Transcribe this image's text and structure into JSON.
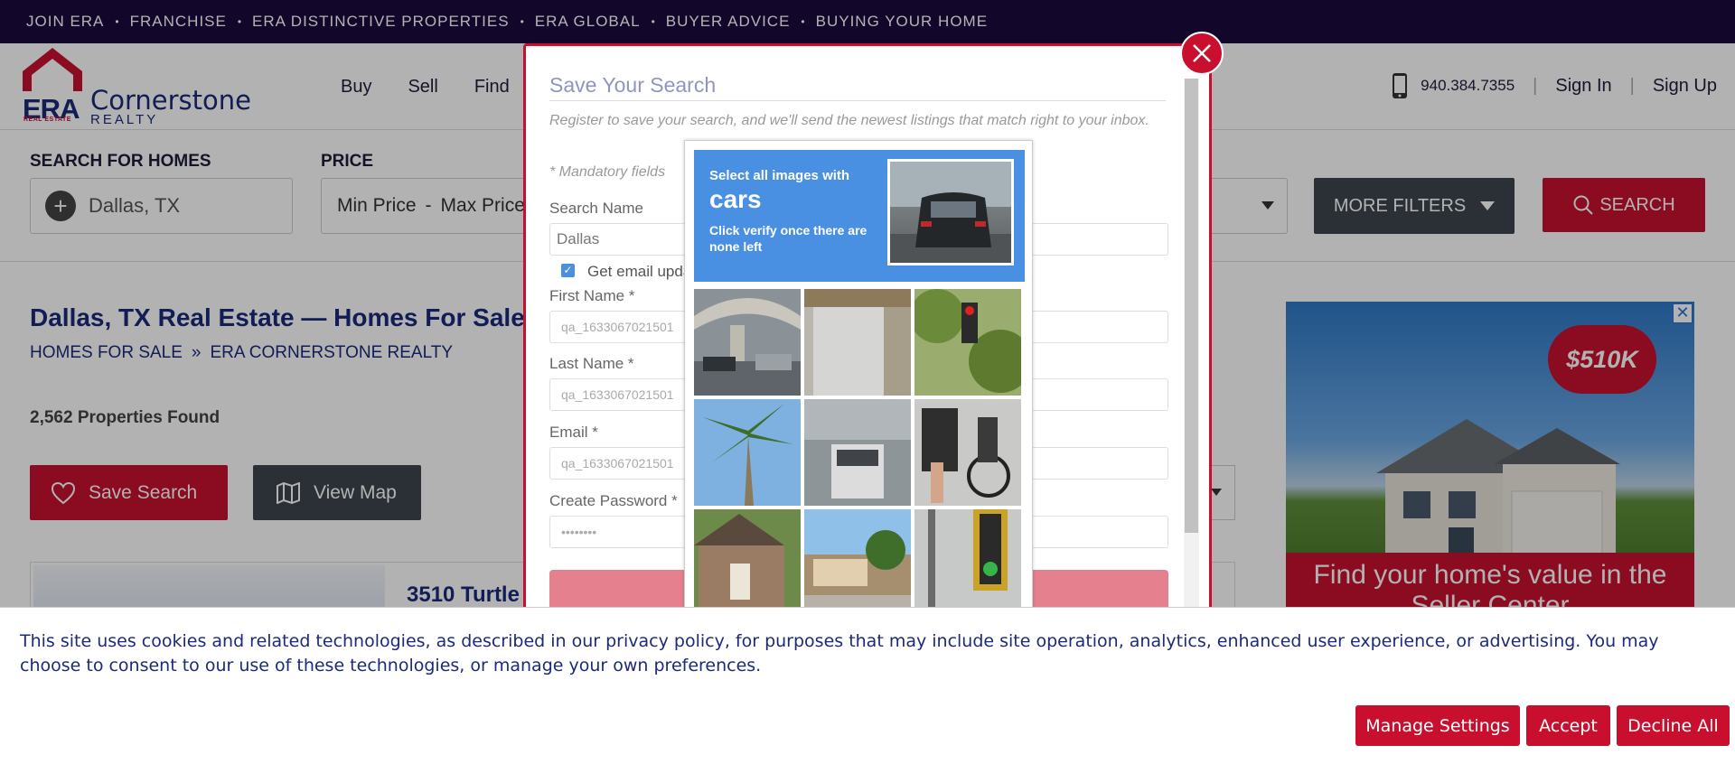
{
  "topbar": {
    "links": [
      "JOIN ERA",
      "FRANCHISE",
      "ERA DISTINCTIVE PROPERTIES",
      "ERA GLOBAL",
      "BUYER ADVICE",
      "BUYING YOUR HOME"
    ],
    "separator": "•"
  },
  "header": {
    "logo": {
      "mark": "ERA",
      "mark_sub": "REAL ESTATE",
      "name": "Cornerstone",
      "name_sub": "REALTY"
    },
    "nav": [
      "Buy",
      "Sell",
      "Find"
    ],
    "phone": "940.384.7355",
    "sign_in": "Sign In",
    "sign_up": "Sign Up",
    "separator": "|"
  },
  "search": {
    "location_label": "SEARCH FOR HOMES",
    "location_value": "Dallas, TX",
    "price_label": "PRICE",
    "min_price": "Min Price",
    "price_dash": "-",
    "max_price": "Max Price",
    "more_filters": "MORE FILTERS",
    "search_button": "SEARCH"
  },
  "page": {
    "title": "Dallas, TX Real Estate — Homes For Sale",
    "breadcrumb": [
      "HOMES FOR SALE",
      "ERA CORNERSTONE REALTY"
    ],
    "breadcrumb_sep": "»",
    "results_count": "2,562 Properties Found",
    "save_search": "Save Search",
    "view_map": "View Map",
    "listing_address": "3510 Turtle"
  },
  "ad": {
    "price_tag": "$510K",
    "close": "✕",
    "banner": "Find your home's value in the Seller Center"
  },
  "modal": {
    "title": "Save Your Search",
    "description": "Register to save your search, and we'll send the newest listings that match right to your inbox.",
    "mandatory_note": "* Mandatory fields",
    "search_name_label": "Search Name",
    "search_name_value": "Dallas",
    "email_updates_label": "Get email updates",
    "email_updates_checked": true,
    "first_name_label": "First Name *",
    "first_name_value": "qa_1633067021501",
    "last_name_label": "Last Name *",
    "last_name_value": "qa_1633067021501",
    "email_label": "Email *",
    "email_value": "qa_1633067021501",
    "password_label": "Create Password *",
    "password_value": "••••••••"
  },
  "captcha": {
    "instruction_line1": "Select all images with",
    "target": "cars",
    "instruction_line2": "Click verify once there are none left",
    "tiles": [
      "road-overpass",
      "concrete-pillar",
      "traffic-light-tree",
      "palm-tree",
      "van-on-road",
      "cyclist",
      "brick-house",
      "street-houses",
      "traffic-light-green"
    ]
  },
  "cookie": {
    "text": "This site uses cookies and related technologies, as described in our privacy policy, for purposes that may include site operation, analytics, enhanced user experience, or advertising. You may choose to consent to our use of these technologies, or manage your own preferences.",
    "manage": "Manage Settings",
    "accept": "Accept",
    "decline": "Decline All"
  },
  "colors": {
    "brand_red": "#c8102e",
    "brand_navy": "#1c2a7a",
    "topbar_bg": "#1c0a3e",
    "dark_button": "#3e4650",
    "captcha_blue": "#4a90e2"
  }
}
